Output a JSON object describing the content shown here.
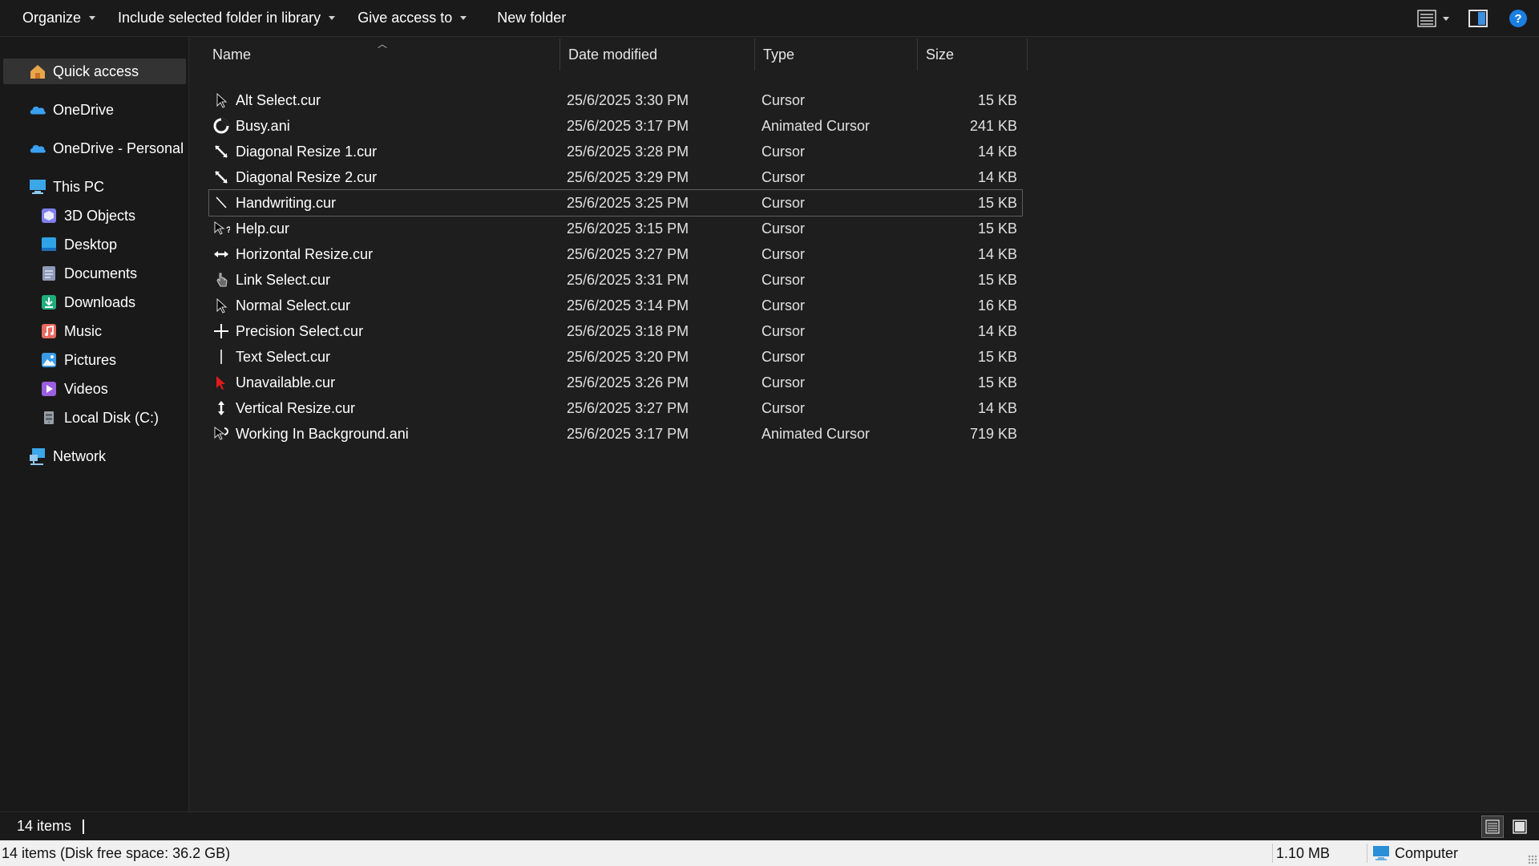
{
  "toolbar": {
    "organize": "Organize",
    "include": "Include selected folder in library",
    "give_access": "Give access to",
    "new_folder": "New folder"
  },
  "sidebar": {
    "items": [
      {
        "label": "Quick access",
        "icon": "star-home-icon"
      },
      {
        "label": "OneDrive",
        "icon": "cloud-icon"
      },
      {
        "label": "OneDrive - Personal",
        "icon": "cloud-icon"
      },
      {
        "label": "This PC",
        "icon": "computer-icon"
      },
      {
        "label": "3D Objects",
        "icon": "cube-icon"
      },
      {
        "label": "Desktop",
        "icon": "desktop-icon"
      },
      {
        "label": "Documents",
        "icon": "document-icon"
      },
      {
        "label": "Downloads",
        "icon": "download-icon"
      },
      {
        "label": "Music",
        "icon": "music-icon"
      },
      {
        "label": "Pictures",
        "icon": "picture-icon"
      },
      {
        "label": "Videos",
        "icon": "video-icon"
      },
      {
        "label": "Local Disk (C:)",
        "icon": "disk-icon"
      },
      {
        "label": "Network",
        "icon": "network-icon"
      }
    ]
  },
  "columns": {
    "name": "Name",
    "date": "Date modified",
    "type": "Type",
    "size": "Size"
  },
  "files": [
    {
      "name": "Alt Select.cur",
      "date": "25/6/2025 3:30 PM",
      "type": "Cursor",
      "size": "15 KB"
    },
    {
      "name": "Busy.ani",
      "date": "25/6/2025 3:17 PM",
      "type": "Animated Cursor",
      "size": "241 KB"
    },
    {
      "name": "Diagonal Resize 1.cur",
      "date": "25/6/2025 3:28 PM",
      "type": "Cursor",
      "size": "14 KB"
    },
    {
      "name": "Diagonal Resize 2.cur",
      "date": "25/6/2025 3:29 PM",
      "type": "Cursor",
      "size": "14 KB"
    },
    {
      "name": "Handwriting.cur",
      "date": "25/6/2025 3:25 PM",
      "type": "Cursor",
      "size": "15 KB"
    },
    {
      "name": "Help.cur",
      "date": "25/6/2025 3:15 PM",
      "type": "Cursor",
      "size": "15 KB"
    },
    {
      "name": "Horizontal Resize.cur",
      "date": "25/6/2025 3:27 PM",
      "type": "Cursor",
      "size": "14 KB"
    },
    {
      "name": "Link Select.cur",
      "date": "25/6/2025 3:31 PM",
      "type": "Cursor",
      "size": "15 KB"
    },
    {
      "name": "Normal Select.cur",
      "date": "25/6/2025 3:14 PM",
      "type": "Cursor",
      "size": "16 KB"
    },
    {
      "name": "Precision Select.cur",
      "date": "25/6/2025 3:18 PM",
      "type": "Cursor",
      "size": "14 KB"
    },
    {
      "name": "Text Select.cur",
      "date": "25/6/2025 3:20 PM",
      "type": "Cursor",
      "size": "15 KB"
    },
    {
      "name": "Unavailable.cur",
      "date": "25/6/2025 3:26 PM",
      "type": "Cursor",
      "size": "15 KB"
    },
    {
      "name": "Vertical Resize.cur",
      "date": "25/6/2025 3:27 PM",
      "type": "Cursor",
      "size": "14 KB"
    },
    {
      "name": "Working In Background.ani",
      "date": "25/6/2025 3:17 PM",
      "type": "Animated Cursor",
      "size": "719 KB"
    }
  ],
  "status": {
    "items_count": "14 items",
    "disk_info": "14 items (Disk free space: 36.2 GB)",
    "total_size": "1.10 MB",
    "location": "Computer"
  }
}
